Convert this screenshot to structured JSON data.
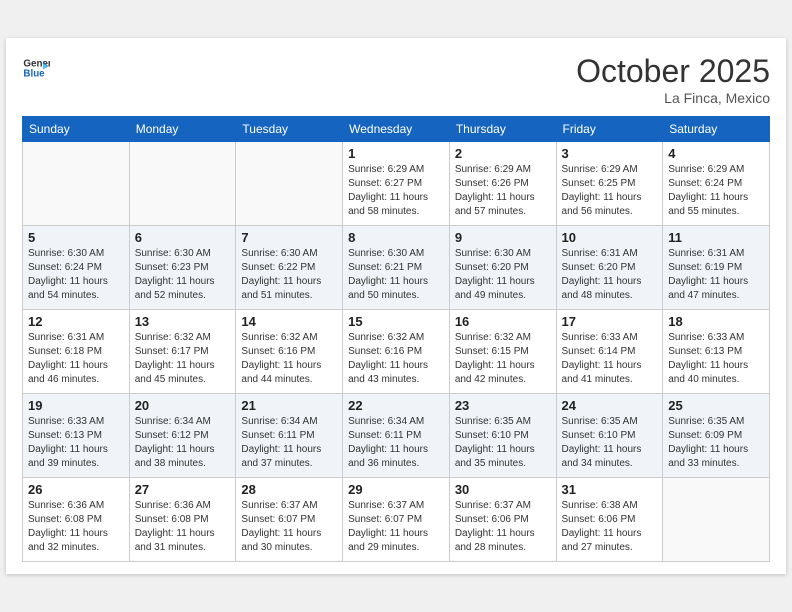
{
  "header": {
    "logo_line1": "General",
    "logo_line2": "Blue",
    "month": "October 2025",
    "location": "La Finca, Mexico"
  },
  "weekdays": [
    "Sunday",
    "Monday",
    "Tuesday",
    "Wednesday",
    "Thursday",
    "Friday",
    "Saturday"
  ],
  "weeks": [
    [
      {
        "day": "",
        "info": ""
      },
      {
        "day": "",
        "info": ""
      },
      {
        "day": "",
        "info": ""
      },
      {
        "day": "1",
        "info": "Sunrise: 6:29 AM\nSunset: 6:27 PM\nDaylight: 11 hours\nand 58 minutes."
      },
      {
        "day": "2",
        "info": "Sunrise: 6:29 AM\nSunset: 6:26 PM\nDaylight: 11 hours\nand 57 minutes."
      },
      {
        "day": "3",
        "info": "Sunrise: 6:29 AM\nSunset: 6:25 PM\nDaylight: 11 hours\nand 56 minutes."
      },
      {
        "day": "4",
        "info": "Sunrise: 6:29 AM\nSunset: 6:24 PM\nDaylight: 11 hours\nand 55 minutes."
      }
    ],
    [
      {
        "day": "5",
        "info": "Sunrise: 6:30 AM\nSunset: 6:24 PM\nDaylight: 11 hours\nand 54 minutes."
      },
      {
        "day": "6",
        "info": "Sunrise: 6:30 AM\nSunset: 6:23 PM\nDaylight: 11 hours\nand 52 minutes."
      },
      {
        "day": "7",
        "info": "Sunrise: 6:30 AM\nSunset: 6:22 PM\nDaylight: 11 hours\nand 51 minutes."
      },
      {
        "day": "8",
        "info": "Sunrise: 6:30 AM\nSunset: 6:21 PM\nDaylight: 11 hours\nand 50 minutes."
      },
      {
        "day": "9",
        "info": "Sunrise: 6:30 AM\nSunset: 6:20 PM\nDaylight: 11 hours\nand 49 minutes."
      },
      {
        "day": "10",
        "info": "Sunrise: 6:31 AM\nSunset: 6:20 PM\nDaylight: 11 hours\nand 48 minutes."
      },
      {
        "day": "11",
        "info": "Sunrise: 6:31 AM\nSunset: 6:19 PM\nDaylight: 11 hours\nand 47 minutes."
      }
    ],
    [
      {
        "day": "12",
        "info": "Sunrise: 6:31 AM\nSunset: 6:18 PM\nDaylight: 11 hours\nand 46 minutes."
      },
      {
        "day": "13",
        "info": "Sunrise: 6:32 AM\nSunset: 6:17 PM\nDaylight: 11 hours\nand 45 minutes."
      },
      {
        "day": "14",
        "info": "Sunrise: 6:32 AM\nSunset: 6:16 PM\nDaylight: 11 hours\nand 44 minutes."
      },
      {
        "day": "15",
        "info": "Sunrise: 6:32 AM\nSunset: 6:16 PM\nDaylight: 11 hours\nand 43 minutes."
      },
      {
        "day": "16",
        "info": "Sunrise: 6:32 AM\nSunset: 6:15 PM\nDaylight: 11 hours\nand 42 minutes."
      },
      {
        "day": "17",
        "info": "Sunrise: 6:33 AM\nSunset: 6:14 PM\nDaylight: 11 hours\nand 41 minutes."
      },
      {
        "day": "18",
        "info": "Sunrise: 6:33 AM\nSunset: 6:13 PM\nDaylight: 11 hours\nand 40 minutes."
      }
    ],
    [
      {
        "day": "19",
        "info": "Sunrise: 6:33 AM\nSunset: 6:13 PM\nDaylight: 11 hours\nand 39 minutes."
      },
      {
        "day": "20",
        "info": "Sunrise: 6:34 AM\nSunset: 6:12 PM\nDaylight: 11 hours\nand 38 minutes."
      },
      {
        "day": "21",
        "info": "Sunrise: 6:34 AM\nSunset: 6:11 PM\nDaylight: 11 hours\nand 37 minutes."
      },
      {
        "day": "22",
        "info": "Sunrise: 6:34 AM\nSunset: 6:11 PM\nDaylight: 11 hours\nand 36 minutes."
      },
      {
        "day": "23",
        "info": "Sunrise: 6:35 AM\nSunset: 6:10 PM\nDaylight: 11 hours\nand 35 minutes."
      },
      {
        "day": "24",
        "info": "Sunrise: 6:35 AM\nSunset: 6:10 PM\nDaylight: 11 hours\nand 34 minutes."
      },
      {
        "day": "25",
        "info": "Sunrise: 6:35 AM\nSunset: 6:09 PM\nDaylight: 11 hours\nand 33 minutes."
      }
    ],
    [
      {
        "day": "26",
        "info": "Sunrise: 6:36 AM\nSunset: 6:08 PM\nDaylight: 11 hours\nand 32 minutes."
      },
      {
        "day": "27",
        "info": "Sunrise: 6:36 AM\nSunset: 6:08 PM\nDaylight: 11 hours\nand 31 minutes."
      },
      {
        "day": "28",
        "info": "Sunrise: 6:37 AM\nSunset: 6:07 PM\nDaylight: 11 hours\nand 30 minutes."
      },
      {
        "day": "29",
        "info": "Sunrise: 6:37 AM\nSunset: 6:07 PM\nDaylight: 11 hours\nand 29 minutes."
      },
      {
        "day": "30",
        "info": "Sunrise: 6:37 AM\nSunset: 6:06 PM\nDaylight: 11 hours\nand 28 minutes."
      },
      {
        "day": "31",
        "info": "Sunrise: 6:38 AM\nSunset: 6:06 PM\nDaylight: 11 hours\nand 27 minutes."
      },
      {
        "day": "",
        "info": ""
      }
    ]
  ]
}
